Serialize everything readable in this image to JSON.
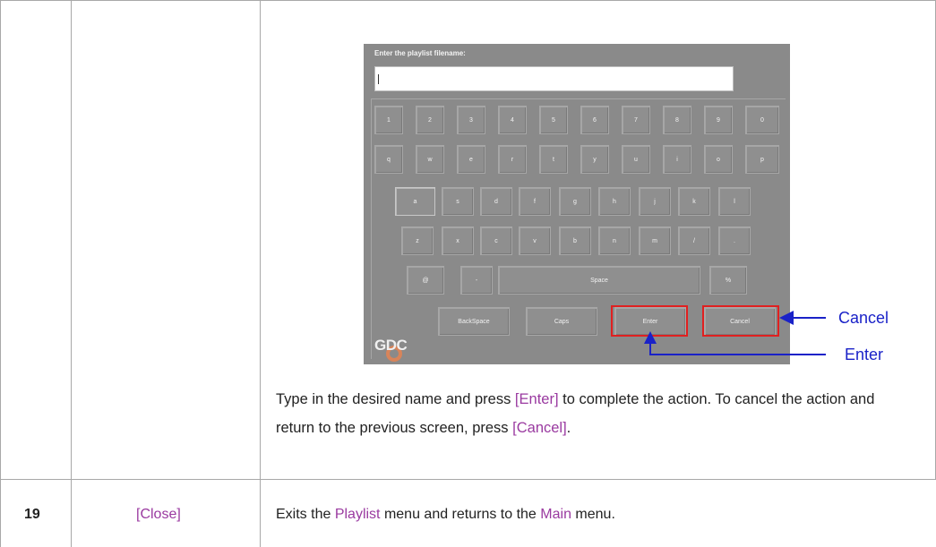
{
  "keyboard": {
    "prompt": "Enter the playlist filename:",
    "rows": [
      [
        "1",
        "2",
        "3",
        "4",
        "5",
        "6",
        "7",
        "8",
        "9",
        "0"
      ],
      [
        "q",
        "w",
        "e",
        "r",
        "t",
        "y",
        "u",
        "i",
        "o",
        "p"
      ],
      [
        "a",
        "s",
        "d",
        "f",
        "g",
        "h",
        "j",
        "k",
        "l"
      ],
      [
        "z",
        "x",
        "c",
        "v",
        "b",
        "n",
        "m",
        "/",
        "."
      ],
      [
        "@",
        "-",
        "Space",
        "%"
      ],
      [
        "BackSpace",
        "Caps",
        "Enter",
        "Cancel"
      ]
    ],
    "logo": "GDC"
  },
  "callouts": {
    "cancel": "Cancel",
    "enter": "Enter"
  },
  "description": {
    "part1": "Type in the desired name and press ",
    "enter_link": "[Enter]",
    "part2": " to complete the action. To cancel the action and return to the previous screen, press ",
    "cancel_link": "[Cancel]",
    "part3": "."
  },
  "row19": {
    "number": "19",
    "label": "[Close]",
    "desc_part1": "Exits the ",
    "playlist_link": "Playlist",
    "desc_part2": " menu and returns to the ",
    "main_link": "Main",
    "desc_part3": " menu."
  },
  "colors": {
    "callout_arrow": "#1a22c8",
    "highlight": "#e02020",
    "link": "#9a3aa0"
  }
}
